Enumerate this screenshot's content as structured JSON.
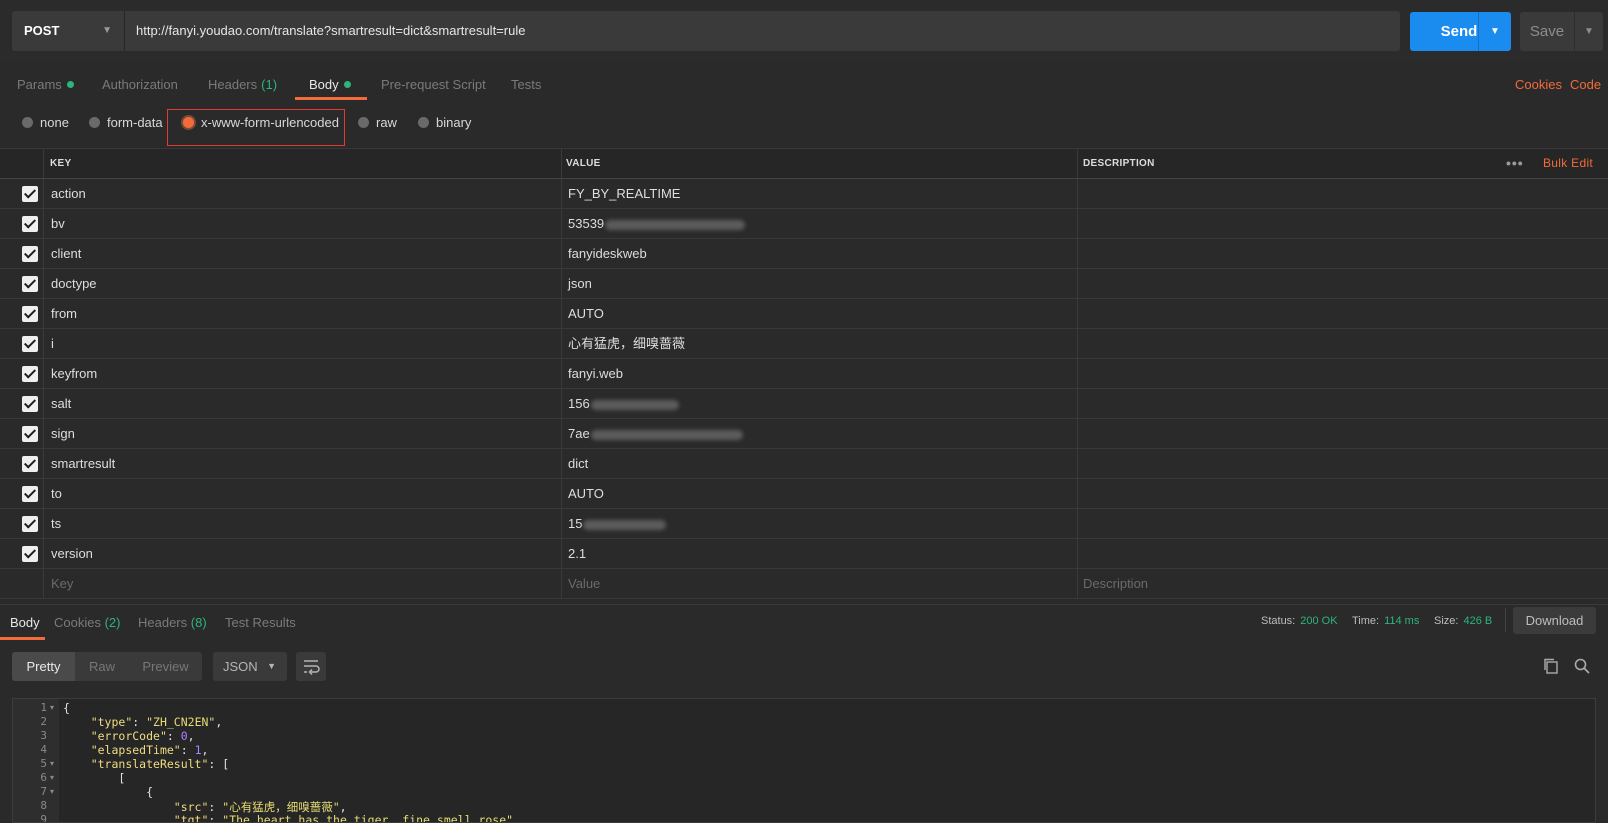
{
  "request": {
    "method": "POST",
    "url": "http://fanyi.youdao.com/translate?smartresult=dict&smartresult=rule",
    "send_label": "Send",
    "save_label": "Save"
  },
  "tabs": {
    "params": "Params",
    "authorization": "Authorization",
    "headers": "Headers",
    "headers_count": "(1)",
    "body": "Body",
    "prerequest": "Pre-request Script",
    "tests": "Tests",
    "cookies": "Cookies",
    "code": "Code"
  },
  "body_types": {
    "none": "none",
    "form_data": "form-data",
    "urlencoded": "x-www-form-urlencoded",
    "raw": "raw",
    "binary": "binary"
  },
  "table": {
    "headers": {
      "key": "KEY",
      "value": "VALUE",
      "description": "DESCRIPTION"
    },
    "bulk_edit": "Bulk Edit",
    "rows": [
      {
        "key": "action",
        "value": "FY_BY_REALTIME"
      },
      {
        "key": "bv",
        "value": "53539"
      },
      {
        "key": "client",
        "value": "fanyideskweb"
      },
      {
        "key": "doctype",
        "value": "json"
      },
      {
        "key": "from",
        "value": "AUTO"
      },
      {
        "key": "i",
        "value": "心有猛虎，细嗅蔷薇"
      },
      {
        "key": "keyfrom",
        "value": "fanyi.web"
      },
      {
        "key": "salt",
        "value": "156"
      },
      {
        "key": "sign",
        "value": "7ae"
      },
      {
        "key": "smartresult",
        "value": "dict"
      },
      {
        "key": "to",
        "value": "AUTO"
      },
      {
        "key": "ts",
        "value": "15"
      },
      {
        "key": "version",
        "value": "2.1"
      }
    ],
    "placeholders": {
      "key": "Key",
      "value": "Value",
      "description": "Description"
    }
  },
  "response": {
    "tabs": {
      "body": "Body",
      "cookies": "Cookies",
      "cookies_count": "(2)",
      "headers": "Headers",
      "headers_count": "(8)",
      "test_results": "Test Results"
    },
    "status_label": "Status:",
    "status_value": "200 OK",
    "time_label": "Time:",
    "time_value": "114 ms",
    "size_label": "Size:",
    "size_value": "426 B",
    "download_label": "Download",
    "views": {
      "pretty": "Pretty",
      "raw": "Raw",
      "preview": "Preview"
    },
    "format": "JSON",
    "code_lines": [
      "{",
      "    \"type\": \"ZH_CN2EN\",",
      "    \"errorCode\": 0,",
      "    \"elapsedTime\": 1,",
      "    \"translateResult\": [",
      "        [",
      "            {",
      "                \"src\": \"心有猛虎，细嗅蔷薇\",",
      "                \"tgt\": \"The heart has the tiger, fine smell rose\"",
      "            }"
    ]
  },
  "colors": {
    "accent": "#f26b3a",
    "send": "#1a8cf0",
    "success": "#2db47d",
    "highlight_border": "#e23a32"
  }
}
